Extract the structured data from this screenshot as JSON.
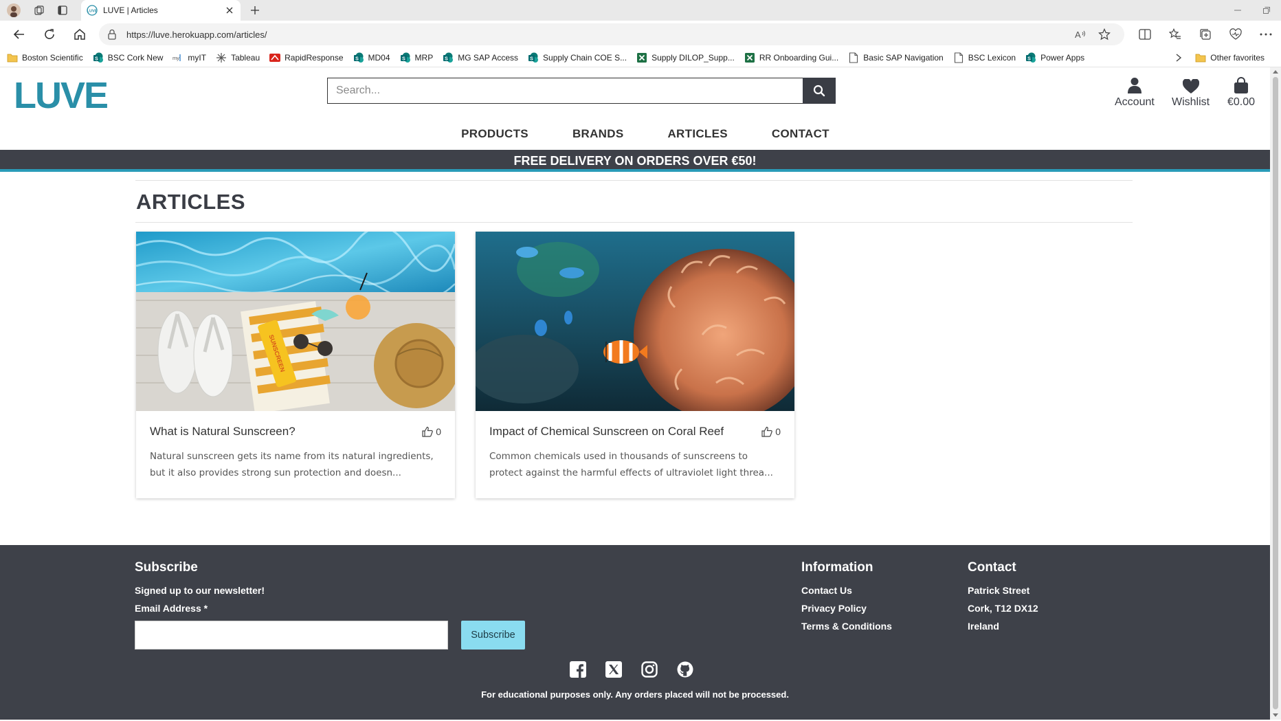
{
  "browser": {
    "tab_title": "LUVE | Articles",
    "url": "https://luve.herokuapp.com/articles/",
    "bookmarks": [
      {
        "label": "Boston Scientific",
        "icon": "folder-icon"
      },
      {
        "label": "BSC Cork New",
        "icon": "sharepoint-icon"
      },
      {
        "label": "myIT",
        "icon": "myit-icon"
      },
      {
        "label": "Tableau",
        "icon": "tableau-icon"
      },
      {
        "label": "RapidResponse",
        "icon": "rapidresponse-icon"
      },
      {
        "label": "MD04",
        "icon": "sharepoint-icon"
      },
      {
        "label": "MRP",
        "icon": "sharepoint-icon"
      },
      {
        "label": "MG SAP Access",
        "icon": "sharepoint-icon"
      },
      {
        "label": "Supply Chain COE S...",
        "icon": "sharepoint-icon"
      },
      {
        "label": "Supply DILOP_Supp...",
        "icon": "excel-icon"
      },
      {
        "label": "RR Onboarding Gui...",
        "icon": "excel-icon"
      },
      {
        "label": "Basic SAP Navigation",
        "icon": "page-icon"
      },
      {
        "label": "BSC Lexicon",
        "icon": "page-icon"
      },
      {
        "label": "Power Apps",
        "icon": "sharepoint-icon"
      }
    ],
    "other_favorites": "Other favorites"
  },
  "site": {
    "logo": "LUVE",
    "search_placeholder": "Search...",
    "account_label": "Account",
    "wishlist_label": "Wishlist",
    "cart_total": "€0.00",
    "nav": [
      "PRODUCTS",
      "BRANDS",
      "ARTICLES",
      "CONTACT"
    ],
    "banner": "FREE DELIVERY ON ORDERS OVER €50!"
  },
  "main": {
    "heading": "ARTICLES",
    "articles": [
      {
        "title": "What is Natural Sunscreen?",
        "likes": "0",
        "excerpt_line1": "Natural sunscreen gets its name from its natural ingredients,",
        "excerpt_line2": "but it also provides strong sun protection and doesn..."
      },
      {
        "title": "Impact of Chemical Sunscreen on Coral Reef",
        "likes": "0",
        "excerpt_line1": "Common chemicals used in thousands of sunscreens to",
        "excerpt_line2": "protect against the harmful effects of ultraviolet light threa..."
      }
    ]
  },
  "footer": {
    "subscribe_heading": "Subscribe",
    "subscribe_status": "Signed up to our newsletter!",
    "email_label": "Email Address",
    "required_mark": "*",
    "subscribe_button": "Subscribe",
    "info_heading": "Information",
    "info_links": [
      "Contact Us",
      "Privacy Policy",
      "Terms & Conditions"
    ],
    "contact_heading": "Contact",
    "contact_lines": [
      "Patrick Street",
      "Cork, T12 DX12",
      "Ireland"
    ],
    "social": [
      "facebook-icon",
      "x-twitter-icon",
      "instagram-icon",
      "github-icon"
    ],
    "disclaimer": "For educational purposes only. Any orders placed will not be processed."
  },
  "colors": {
    "brand": "#2a8fa8",
    "dark": "#3e4149",
    "accent_bar": "#2a9bb8",
    "subscribe_button": "#8adcf0"
  }
}
